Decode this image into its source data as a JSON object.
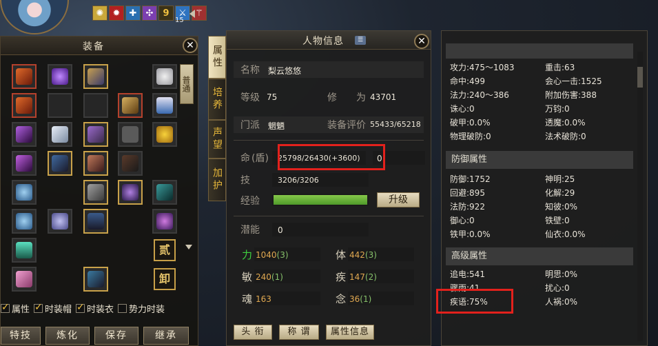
{
  "hud": {
    "buffs": [
      {
        "icon": "buff-swirl-icon",
        "color": "#c9a83a"
      },
      {
        "icon": "buff-fire-icon",
        "color": "#b22020"
      },
      {
        "icon": "buff-cross-icon",
        "color": "#2a6fb0"
      },
      {
        "icon": "buff-pinwheel-icon",
        "color": "#7b3fb0"
      },
      {
        "icon": "buff-nine-icon",
        "color": "#c7a23a"
      },
      {
        "icon": "buff-sword-icon",
        "color": "#2e73c0"
      },
      {
        "icon": "buff-blade-icon",
        "color": "#a03030"
      }
    ],
    "buff_nine_label": "9",
    "buff_count": "15"
  },
  "equipment": {
    "title": "装备",
    "side_tab": "普通",
    "seal_1": "贰",
    "seal_2": "卸",
    "checkboxes": [
      {
        "label": "属性",
        "checked": true
      },
      {
        "label": "时装帽",
        "checked": true
      },
      {
        "label": "时装衣",
        "checked": true
      },
      {
        "label": "势力时装",
        "checked": false
      }
    ],
    "buttons": [
      "特技",
      "炼化",
      "保存",
      "继承"
    ]
  },
  "tabs": [
    "属性",
    "培养",
    "声望",
    "加护"
  ],
  "character": {
    "title": "人物信息",
    "name_label": "名称",
    "name_value": "梨云悠悠",
    "level_label": "等级",
    "level_value": "75",
    "cultivation_label": "修　　为",
    "cultivation_value": "43701",
    "sect_label": "门派",
    "sect_value": "魍魉",
    "equip_score_label": "装备评价",
    "equip_score_value": "55433/65218",
    "hp_label_1": "命",
    "hp_label_2": "(盾)",
    "hp_value": "25798/26430(+3600)",
    "shield_value": "0",
    "skill_label": "技",
    "skill_value": "3206/3206",
    "exp_label": "经验",
    "exp_fill": 1.0,
    "upgrade_button": "升级",
    "potential_label": "潜能",
    "potential_value": "0",
    "attrs": [
      {
        "name": "力",
        "value": "1040",
        "bonus": "(3)",
        "color": "#3fd33f"
      },
      {
        "name": "体",
        "value": "442",
        "bonus": "(3)",
        "color": "#d8d0bc"
      },
      {
        "name": "敏",
        "value": "240",
        "bonus": "(1)",
        "color": "#d8d0bc"
      },
      {
        "name": "疾",
        "value": "147",
        "bonus": "(2)",
        "color": "#d8d0bc"
      },
      {
        "name": "魂",
        "value": "163",
        "bonus": "",
        "color": "#d8d0bc"
      },
      {
        "name": "念",
        "value": "36",
        "bonus": "(1)",
        "color": "#d8d0bc"
      }
    ],
    "bottom_buttons": [
      "头 衔",
      "称 谓",
      "属性信息"
    ]
  },
  "stats": {
    "basic": [
      [
        "攻力:475～1083",
        "重击:63"
      ],
      [
        "命中:499",
        "会心一击:1525"
      ],
      [
        "法力:240～386",
        "附加伤害:388"
      ],
      [
        "诛心:0",
        "万钧:0"
      ],
      [
        "破甲:0.0%",
        "透魔:0.0%"
      ],
      [
        "物理破防:0",
        "法术破防:0"
      ]
    ],
    "defense_title": "防御属性",
    "defense": [
      [
        "防御:1752",
        "神明:25"
      ],
      [
        "回避:895",
        "化解:29"
      ],
      [
        "法防:922",
        "知彼:0%"
      ],
      [
        "御心:0",
        "铁壁:0"
      ],
      [
        "铁甲:0.0%",
        "仙衣:0.0%"
      ]
    ],
    "advanced_title": "高级属性",
    "advanced": [
      [
        "追电:541",
        "明思:0%"
      ],
      [
        "骤雨:41",
        "扰心:0"
      ],
      [
        "疾语:75%",
        "人祸:0%"
      ]
    ]
  },
  "colors": {
    "highlight": "#e3211c",
    "gold": "#c9a24a"
  }
}
